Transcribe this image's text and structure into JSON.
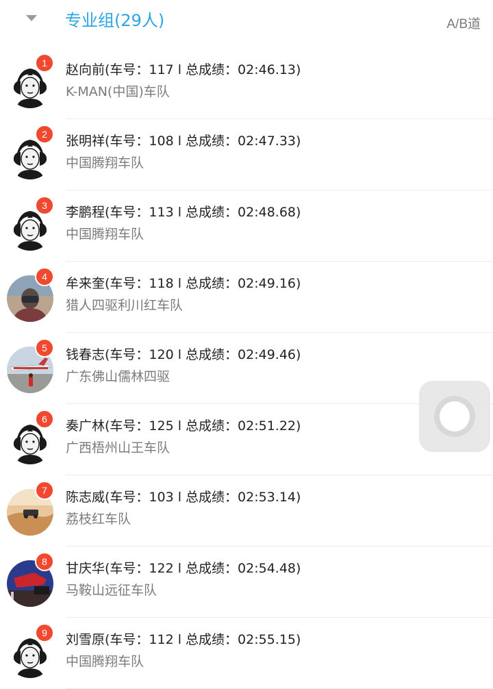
{
  "header": {
    "title": "专业组(29人)",
    "lane": "A/B道",
    "caret_icon": "caret-down-icon"
  },
  "colors": {
    "accent": "#2aa6e4",
    "badge": "#f0492f",
    "subtitle": "#7b7b7b"
  },
  "rows": [
    {
      "rank": "1",
      "line": "赵向前(车号：117 l 总成绩：02:46.13)",
      "team": "K-MAN(中国)车队",
      "avatar": "default"
    },
    {
      "rank": "2",
      "line": "张明祥(车号：108 l 总成绩：02:47.33)",
      "team": "中国腾翔车队",
      "avatar": "default"
    },
    {
      "rank": "3",
      "line": "李鹏程(车号：113 l 总成绩：02:48.68)",
      "team": "中国腾翔车队",
      "avatar": "default"
    },
    {
      "rank": "4",
      "line": "牟来奎(车号：118 l 总成绩：02:49.16)",
      "team": "猎人四驱利川红车队",
      "avatar": "photo-person"
    },
    {
      "rank": "5",
      "line": "钱春志(车号：120 l 总成绩：02:49.46)",
      "team": "广东佛山儒林四驱",
      "avatar": "photo-airplane"
    },
    {
      "rank": "6",
      "line": "奏广林(车号：125 l 总成绩：02:51.22)",
      "team": "广西梧州山王车队",
      "avatar": "default"
    },
    {
      "rank": "7",
      "line": "陈志威(车号：103 l 总成绩：02:53.14)",
      "team": "荔枝红车队",
      "avatar": "photo-desert"
    },
    {
      "rank": "8",
      "line": "甘庆华(车号：122 l 总成绩：02:54.48)",
      "team": "马鞍山远征车队",
      "avatar": "photo-car"
    },
    {
      "rank": "9",
      "line": "刘雪原(车号：112 l 总成绩：02:55.15)",
      "team": "中国腾翔车队",
      "avatar": "default"
    }
  ],
  "floating_button": {
    "icon": "assistive-touch-icon"
  }
}
